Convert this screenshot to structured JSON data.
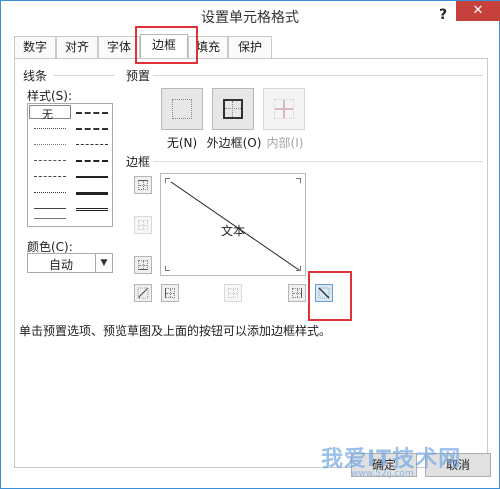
{
  "window": {
    "title": "设置单元格格式",
    "help": "?",
    "close": "✕"
  },
  "tabs": [
    {
      "label": "数字"
    },
    {
      "label": "对齐"
    },
    {
      "label": "字体"
    },
    {
      "label": "边框"
    },
    {
      "label": "填充"
    },
    {
      "label": "保护"
    }
  ],
  "active_tab": "边框",
  "line": {
    "group_label": "线条",
    "style_label": "样式(S):",
    "none_label": "无",
    "color_label": "颜色(C):",
    "color_value": "自动"
  },
  "presets": {
    "group_label": "预置",
    "items": [
      {
        "label": "无(N)"
      },
      {
        "label": "外边框(O)"
      },
      {
        "label": "内部(I)"
      }
    ]
  },
  "border": {
    "group_label": "边框",
    "preview_text": "文本"
  },
  "hint": "单击预置选项、预览草图及上面的按钮可以添加边框样式。",
  "buttons": {
    "ok": "确定",
    "cancel": "取消"
  },
  "watermark": {
    "text": "我爱IT技术网",
    "url": "www.52ij.com"
  },
  "colors": {
    "highlight": "#e0323a",
    "accent": "#3d8fd6",
    "close": "#c7413c"
  }
}
